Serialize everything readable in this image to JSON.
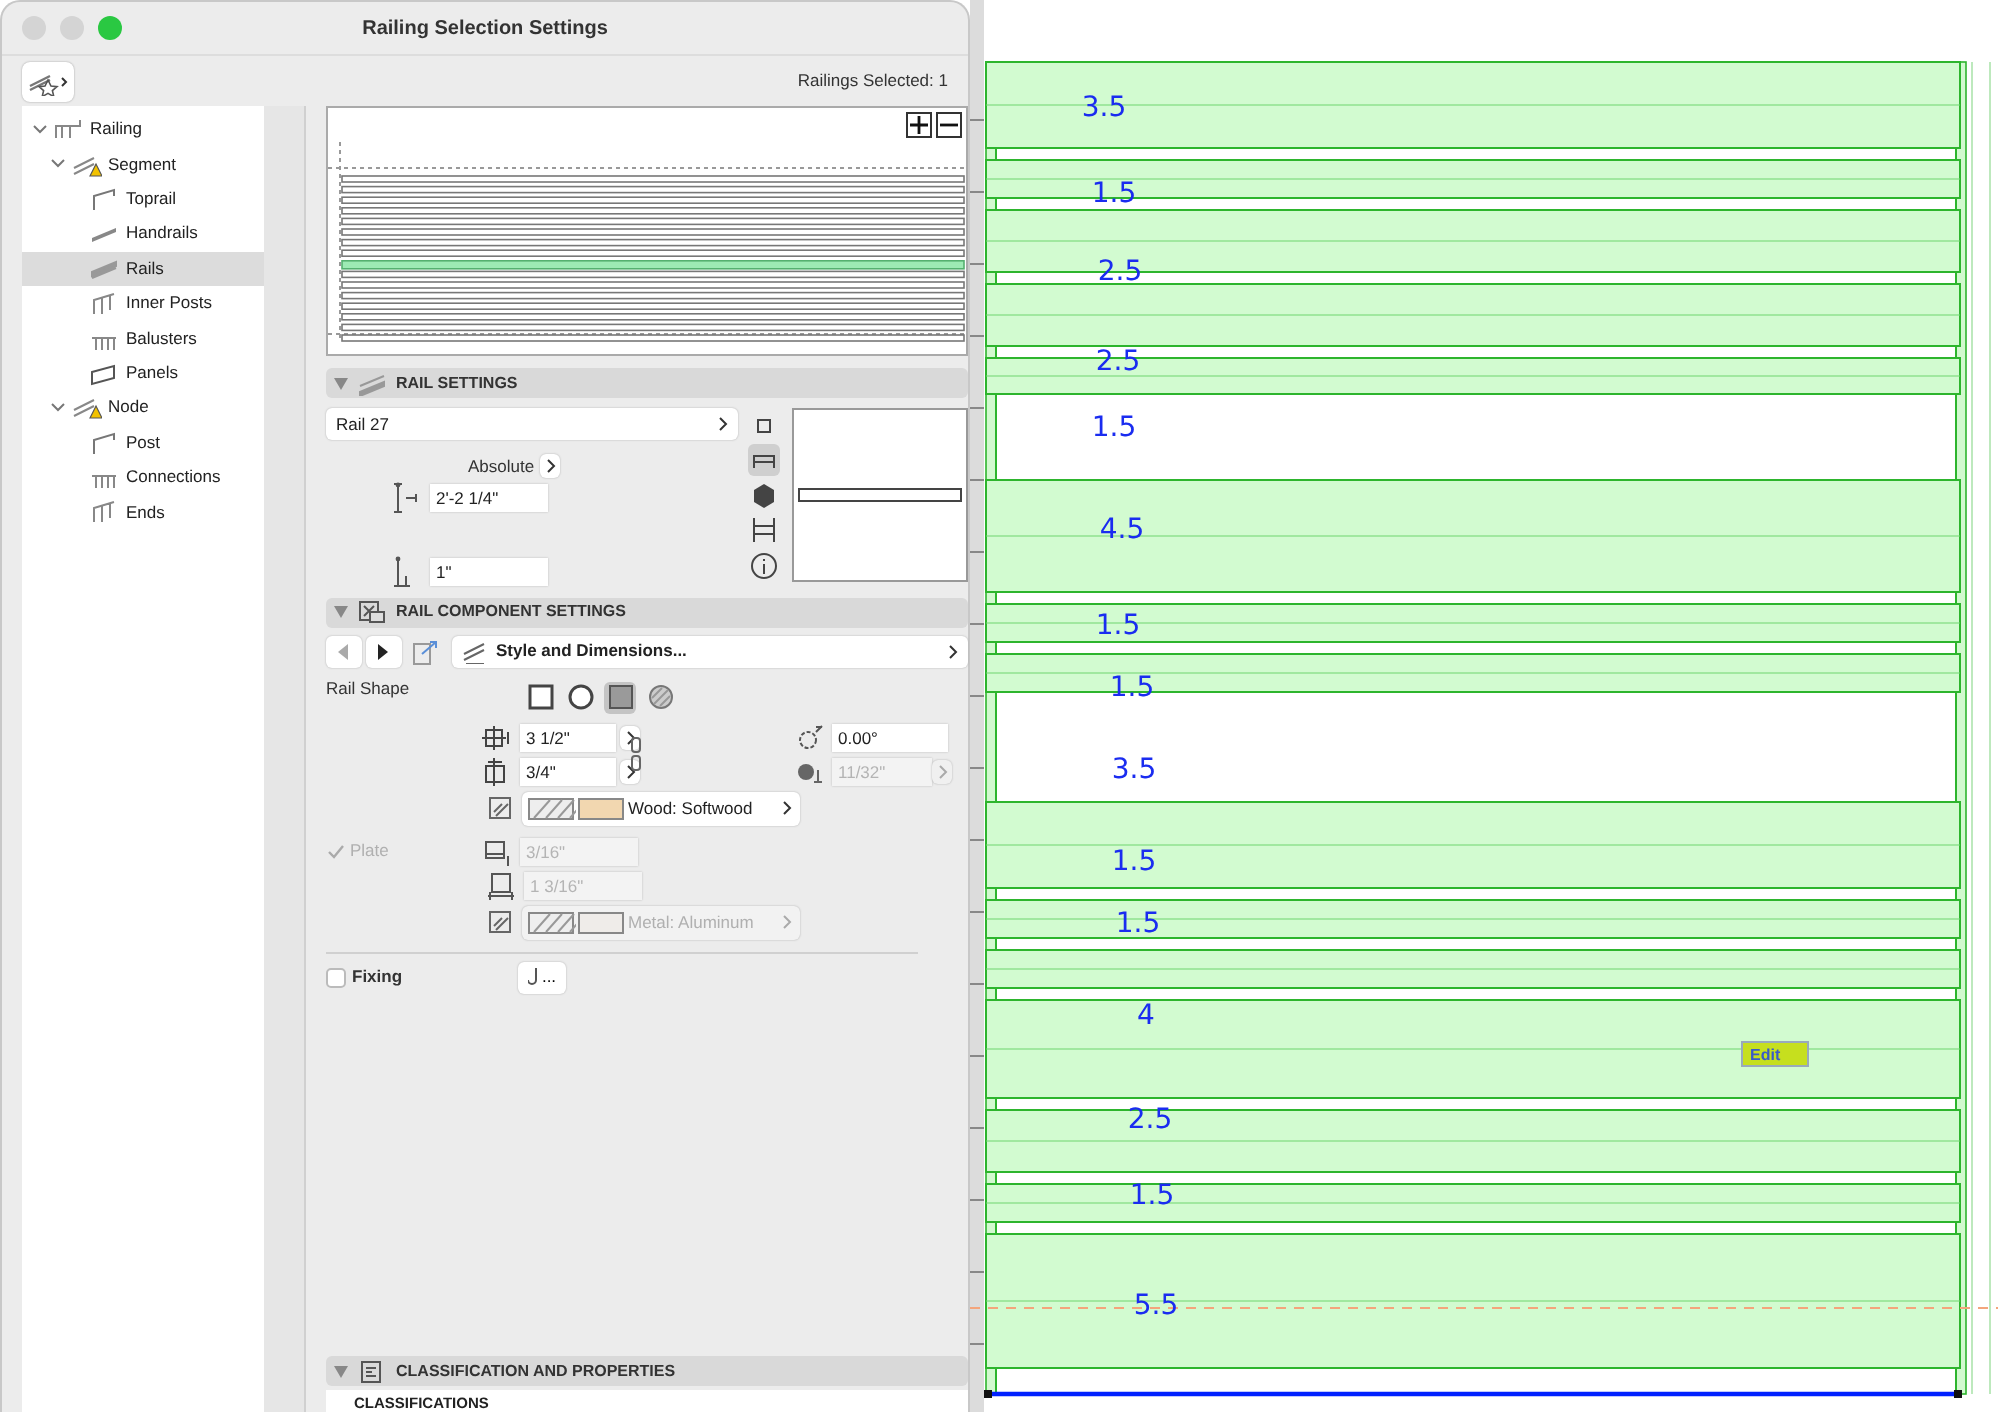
{
  "window": {
    "title": "Railing Selection Settings"
  },
  "toolbar": {
    "selection_count": "Railings Selected: 1"
  },
  "tree": [
    {
      "label": "Railing",
      "kind": "railing",
      "expanded": true,
      "selected": false,
      "children": [
        {
          "label": "Segment",
          "kind": "segment",
          "expanded": true,
          "warning": true,
          "selected": false,
          "children": [
            {
              "label": "Toprail",
              "kind": "toprail",
              "selected": false
            },
            {
              "label": "Handrails",
              "kind": "handrail",
              "selected": false
            },
            {
              "label": "Rails",
              "kind": "rail",
              "selected": true
            },
            {
              "label": "Inner Posts",
              "kind": "post",
              "selected": false
            },
            {
              "label": "Balusters",
              "kind": "baluster",
              "selected": false
            },
            {
              "label": "Panels",
              "kind": "panel",
              "selected": false
            }
          ]
        },
        {
          "label": "Node",
          "kind": "segment",
          "expanded": true,
          "warning": true,
          "selected": false,
          "children": [
            {
              "label": "Post",
              "kind": "toprail",
              "selected": false
            },
            {
              "label": "Connections",
              "kind": "baluster",
              "selected": false
            },
            {
              "label": "Ends",
              "kind": "post",
              "selected": false
            }
          ]
        }
      ]
    }
  ],
  "preview": {
    "rails": [
      {
        "selected": false
      },
      {
        "selected": false
      },
      {
        "selected": false
      },
      {
        "selected": false
      },
      {
        "selected": false
      },
      {
        "selected": false
      },
      {
        "selected": false
      },
      {
        "selected": false
      },
      {
        "selected": true
      },
      {
        "selected": false
      },
      {
        "selected": false
      },
      {
        "selected": false
      },
      {
        "selected": false
      },
      {
        "selected": false
      },
      {
        "selected": false
      },
      {
        "selected": false
      }
    ]
  },
  "rail_settings": {
    "title": "RAIL SETTINGS",
    "expanded": true,
    "rail_name": "Rail 27",
    "reference": "Absolute",
    "height": "2'-2 1/4\"",
    "offset": "1\"",
    "view_modes": [
      {
        "kind": "outline",
        "selected": false
      },
      {
        "kind": "profile",
        "selected": true
      },
      {
        "kind": "model",
        "selected": false
      },
      {
        "kind": "frame",
        "selected": false
      },
      {
        "kind": "info",
        "selected": false
      }
    ]
  },
  "component_settings": {
    "title": "RAIL COMPONENT SETTINGS",
    "expanded": true,
    "back_disabled": true,
    "page": "Style and Dimensions...",
    "shape_label": "Rail Shape",
    "shapes": [
      {
        "kind": "square",
        "selected": false
      },
      {
        "kind": "circle",
        "selected": false
      },
      {
        "kind": "filled-square",
        "selected": true
      },
      {
        "kind": "hatched-circle",
        "selected": false
      }
    ],
    "width": "3 1/2\"",
    "depth": "3/4\"",
    "angle": "0.00°",
    "radius": "11/32\"",
    "radius_disabled": true,
    "material": "Wood: Softwood",
    "plate": {
      "label": "Plate",
      "checked": true,
      "disabled": true,
      "thickness": "3/16\"",
      "width": "1 3/16\"",
      "material": "Metal: Aluminum"
    },
    "fixing": {
      "label": "Fixing",
      "checked": false,
      "button_label": "..."
    }
  },
  "classification": {
    "title": "CLASSIFICATION AND PROPERTIES",
    "expanded": true,
    "column_1": "CLASSIFICATIONS"
  },
  "canvas": {
    "dimension_labels": [
      "3.5",
      "1.5",
      "2.5",
      "2.5",
      "1.5",
      "4.5",
      "1.5",
      "1.5",
      "3.5",
      "1.5",
      "1.5",
      "4",
      "2.5",
      "1.5",
      "5.5"
    ],
    "edit_tag": "Edit"
  }
}
